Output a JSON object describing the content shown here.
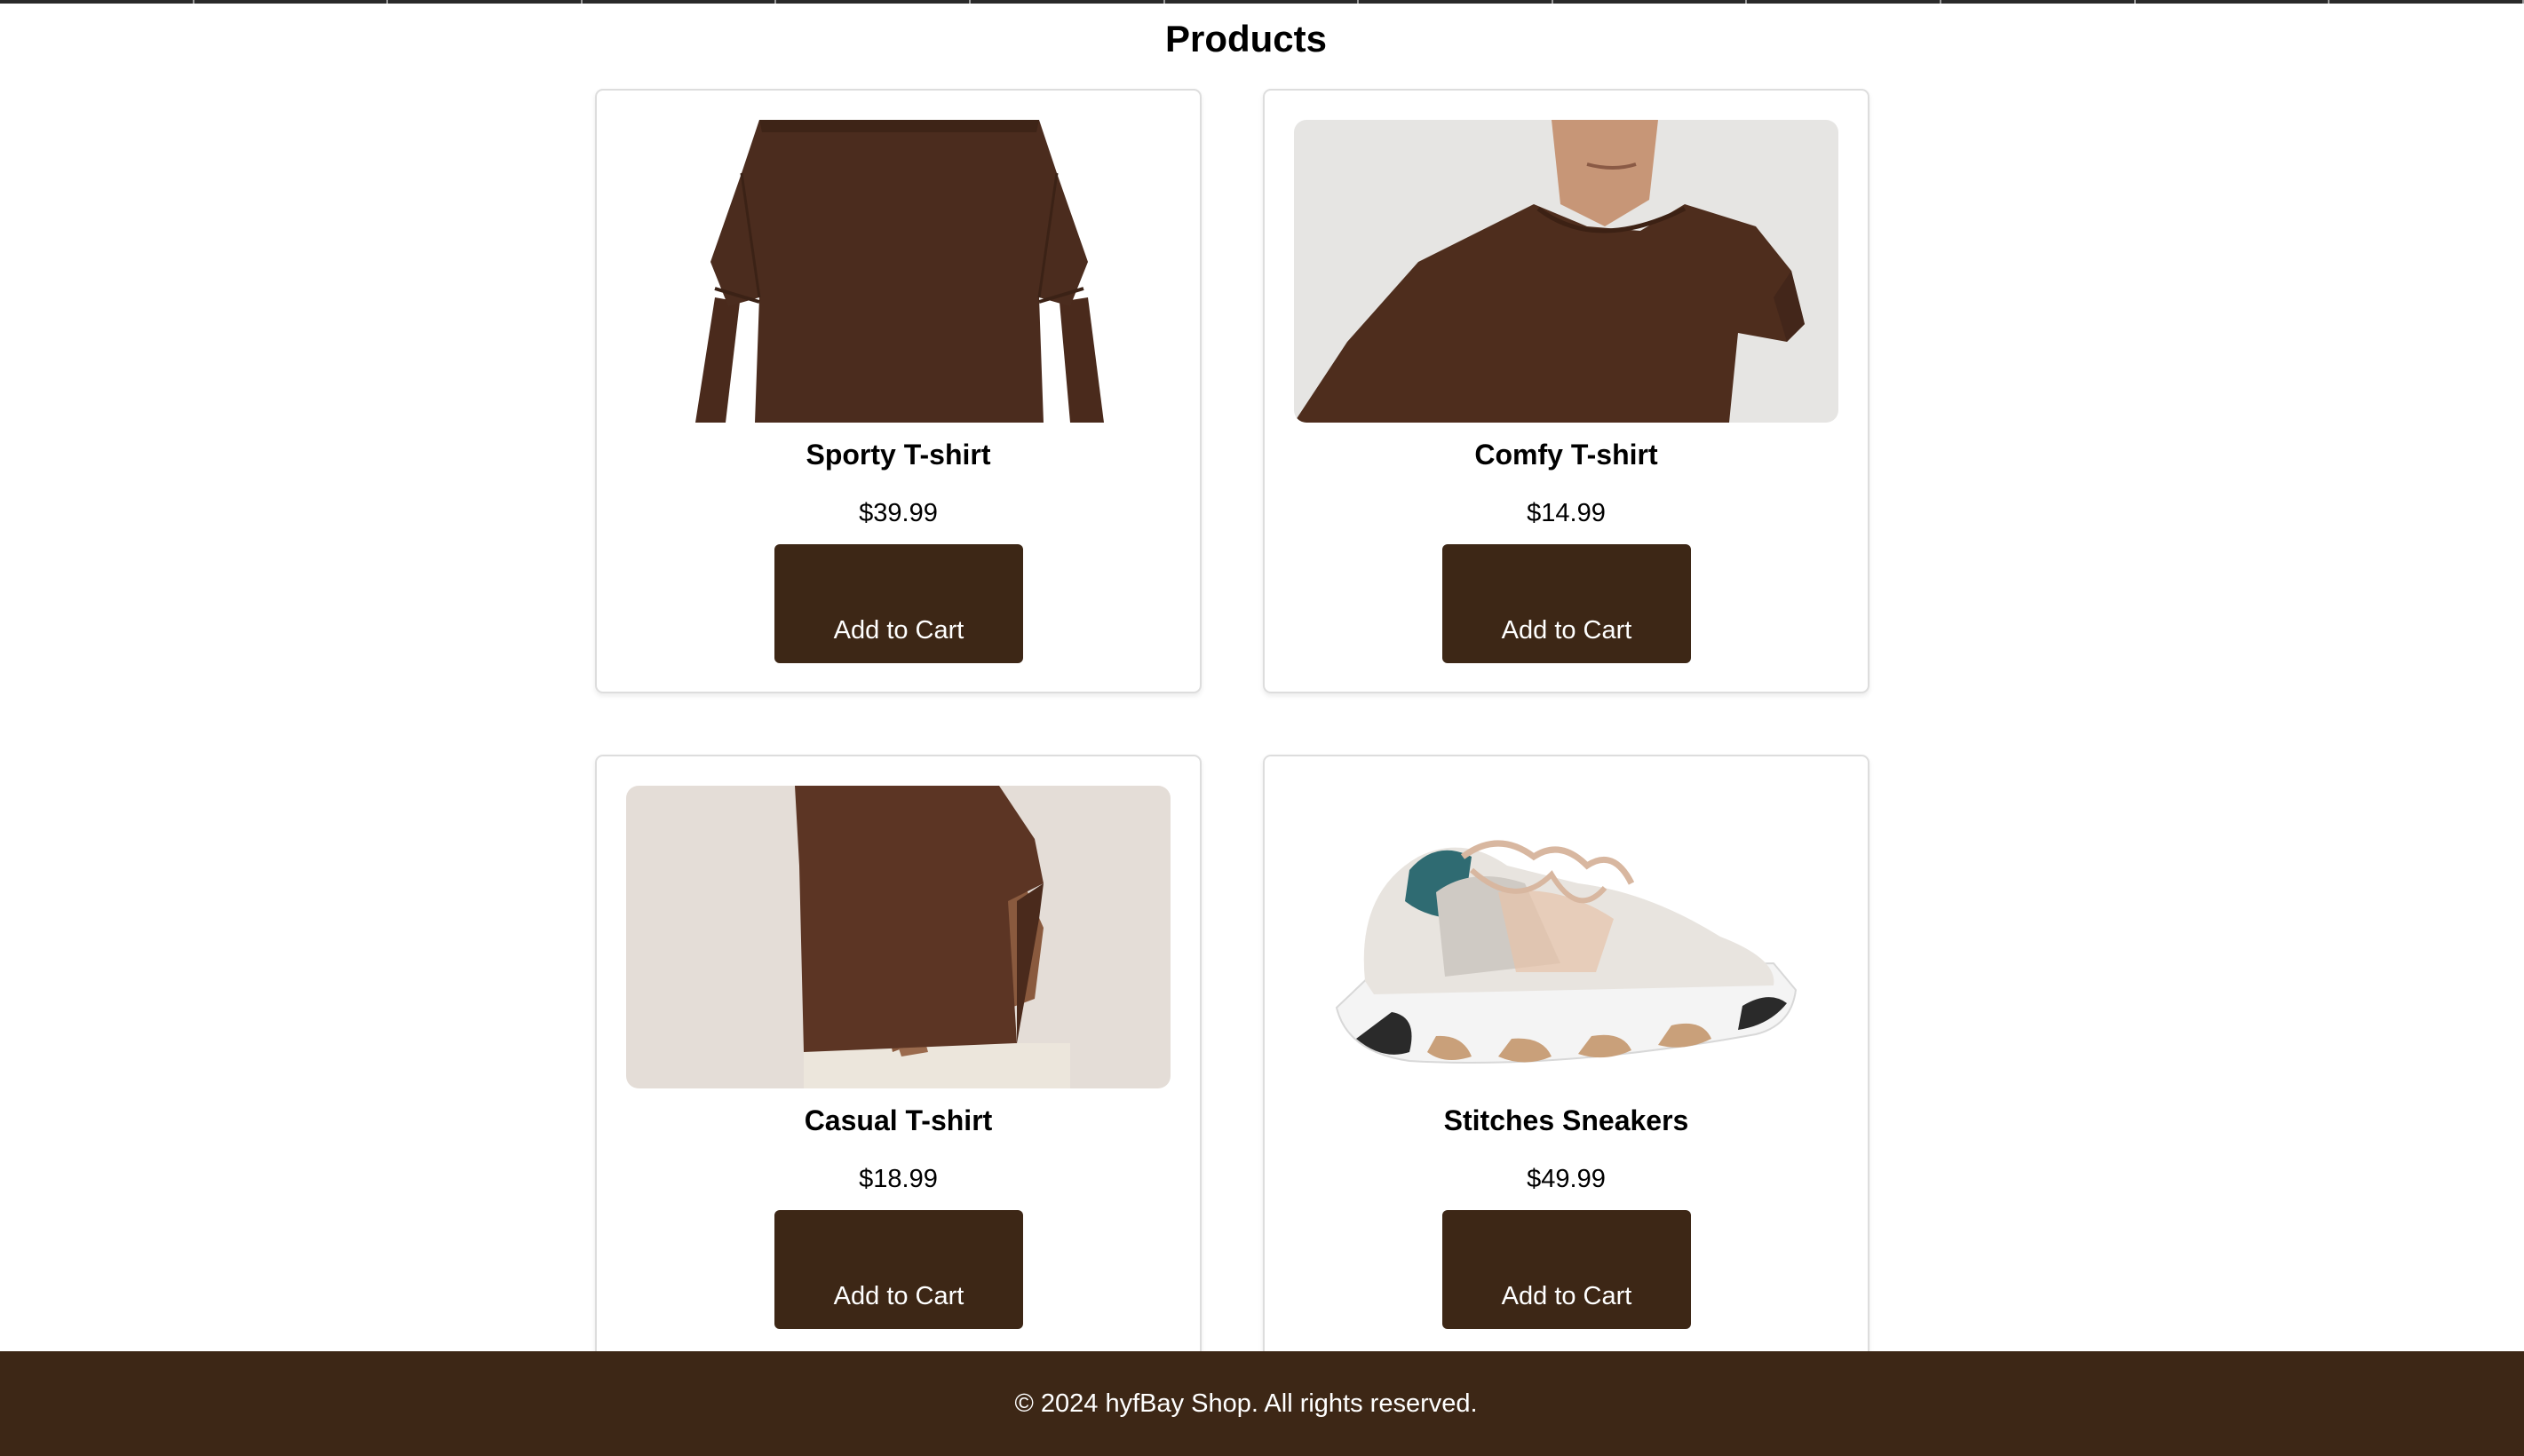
{
  "page": {
    "title": "Products"
  },
  "products": [
    {
      "name": "Sporty T-shirt",
      "price": "$39.99",
      "button_label": "Add to Cart",
      "image": "brown-tshirt-front-photo"
    },
    {
      "name": "Comfy T-shirt",
      "price": "$14.99",
      "button_label": "Add to Cart",
      "image": "woman-brown-tshirt-photo"
    },
    {
      "name": "Casual T-shirt",
      "price": "$18.99",
      "button_label": "Add to Cart",
      "image": "brown-tshirt-side-photo"
    },
    {
      "name": "Stitches Sneakers",
      "price": "$49.99",
      "button_label": "Add to Cart",
      "image": "white-sneaker-photo"
    }
  ],
  "footer": {
    "text": "© 2024 hyfBay Shop. All rights reserved."
  },
  "colors": {
    "accent": "#3d2716",
    "background": "#ffffff",
    "card_border": "#dddddd"
  }
}
